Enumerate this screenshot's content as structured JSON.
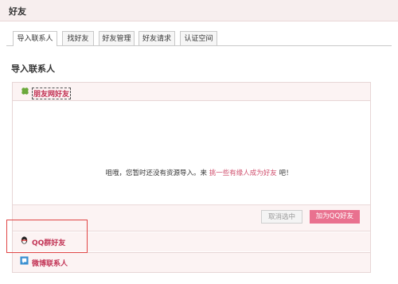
{
  "header": {
    "title": "好友"
  },
  "tabs": [
    {
      "label": "导入联系人",
      "active": true
    },
    {
      "label": "找好友"
    },
    {
      "label": "好友管理"
    },
    {
      "label": "好友请求"
    },
    {
      "label": "认证空间"
    }
  ],
  "section": {
    "title": "导入联系人"
  },
  "sources": [
    {
      "label": "朋友网好友",
      "icon": "clover-icon"
    },
    {
      "label": "QQ群好友",
      "icon": "qq-icon"
    },
    {
      "label": "微博联系人",
      "icon": "weibo-icon"
    }
  ],
  "message": {
    "before": "咀哦，您暂时还没有资源导入。来",
    "link": "挑一些有缘人成为好友",
    "after": "吧！"
  },
  "buttons": {
    "cancel": "取消选中",
    "add": "加为QQ好友"
  },
  "colors": {
    "accent": "#e9718f",
    "link": "#d0506e",
    "header_bg": "#f7eeee",
    "highlight": "#e04545"
  }
}
